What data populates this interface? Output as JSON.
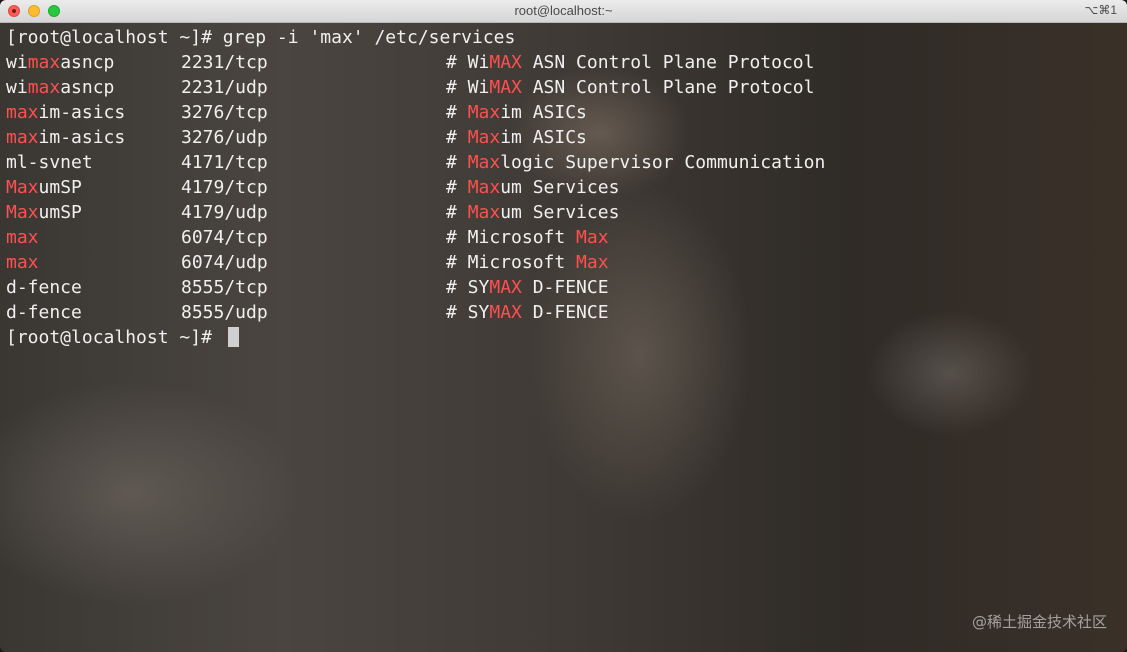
{
  "window": {
    "title": "root@localhost:~",
    "shortcut": "⌥⌘1"
  },
  "terminal": {
    "prompt": "[root@localhost ~]# ",
    "command": "grep -i 'max' /etc/services",
    "rows": [
      {
        "name_pre": "wi",
        "name_hl": "max",
        "name_post": "asncp",
        "port": "2231/tcp",
        "cmt_pre": "# Wi",
        "cmt_hl": "MAX",
        "cmt_post": " ASN Control Plane Protocol"
      },
      {
        "name_pre": "wi",
        "name_hl": "max",
        "name_post": "asncp",
        "port": "2231/udp",
        "cmt_pre": "# Wi",
        "cmt_hl": "MAX",
        "cmt_post": " ASN Control Plane Protocol"
      },
      {
        "name_pre": "",
        "name_hl": "max",
        "name_post": "im-asics",
        "port": "3276/tcp",
        "cmt_pre": "# ",
        "cmt_hl": "Max",
        "cmt_post": "im ASICs"
      },
      {
        "name_pre": "",
        "name_hl": "max",
        "name_post": "im-asics",
        "port": "3276/udp",
        "cmt_pre": "# ",
        "cmt_hl": "Max",
        "cmt_post": "im ASICs"
      },
      {
        "name_pre": "ml-svnet",
        "name_hl": "",
        "name_post": "",
        "port": "4171/tcp",
        "cmt_pre": "# ",
        "cmt_hl": "Max",
        "cmt_post": "logic Supervisor Communication"
      },
      {
        "name_pre": "",
        "name_hl": "Max",
        "name_post": "umSP",
        "port": "4179/tcp",
        "cmt_pre": "# ",
        "cmt_hl": "Max",
        "cmt_post": "um Services"
      },
      {
        "name_pre": "",
        "name_hl": "Max",
        "name_post": "umSP",
        "port": "4179/udp",
        "cmt_pre": "# ",
        "cmt_hl": "Max",
        "cmt_post": "um Services"
      },
      {
        "name_pre": "",
        "name_hl": "max",
        "name_post": "",
        "port": "6074/tcp",
        "cmt_pre": "# Microsoft ",
        "cmt_hl": "Max",
        "cmt_post": ""
      },
      {
        "name_pre": "",
        "name_hl": "max",
        "name_post": "",
        "port": "6074/udp",
        "cmt_pre": "# Microsoft ",
        "cmt_hl": "Max",
        "cmt_post": ""
      },
      {
        "name_pre": "d-fence",
        "name_hl": "",
        "name_post": "",
        "port": "8555/tcp",
        "cmt_pre": "# SY",
        "cmt_hl": "MAX",
        "cmt_post": " D-FENCE"
      },
      {
        "name_pre": "d-fence",
        "name_hl": "",
        "name_post": "",
        "port": "8555/udp",
        "cmt_pre": "# SY",
        "cmt_hl": "MAX",
        "cmt_post": " D-FENCE"
      }
    ]
  },
  "watermark": "@稀土掘金技术社区",
  "colors": {
    "match_highlight": "#ff4f4f",
    "text": "#f0f0f0"
  }
}
